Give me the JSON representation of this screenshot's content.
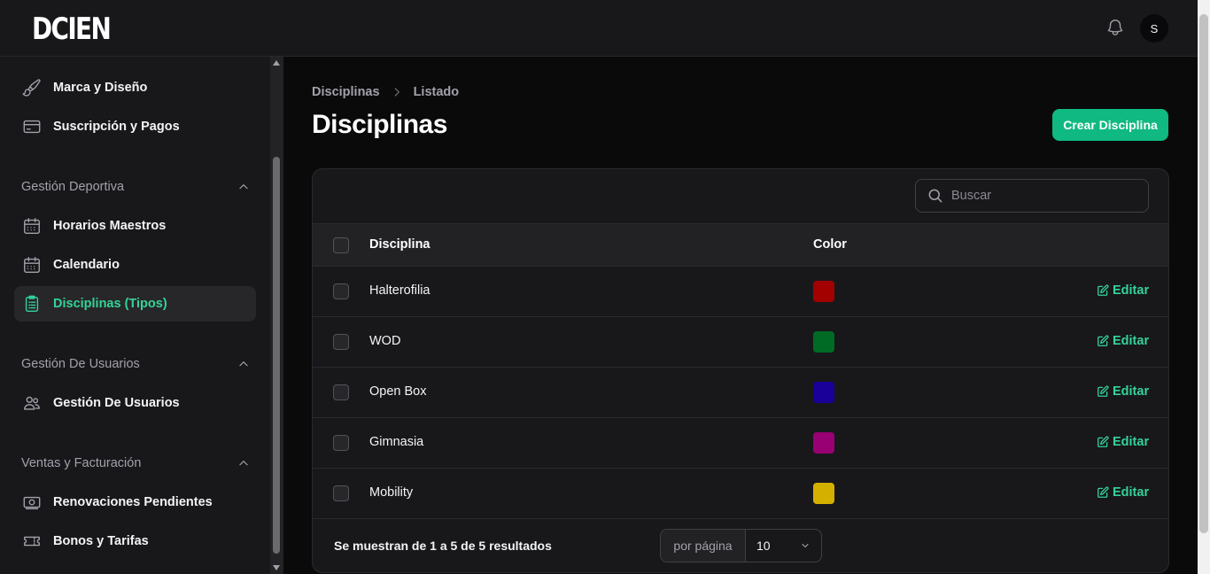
{
  "app": {
    "logo": "DCIEN",
    "avatar_initial": "S"
  },
  "sidebar": {
    "top_items": [
      {
        "label": "Marca y Diseño",
        "icon": "brush-icon"
      },
      {
        "label": "Suscripción y Pagos",
        "icon": "credit-card-icon"
      }
    ],
    "groups": [
      {
        "label": "Gestión Deportiva",
        "items": [
          {
            "label": "Horarios Maestros",
            "icon": "calendar-icon"
          },
          {
            "label": "Calendario",
            "icon": "calendar-icon"
          },
          {
            "label": "Disciplinas (Tipos)",
            "icon": "clipboard-list-icon",
            "active": true
          }
        ]
      },
      {
        "label": "Gestión De Usuarios",
        "items": [
          {
            "label": "Gestión De Usuarios",
            "icon": "users-icon"
          }
        ]
      },
      {
        "label": "Ventas y Facturación",
        "items": [
          {
            "label": "Renovaciones Pendientes",
            "icon": "banknotes-icon"
          },
          {
            "label": "Bonos y Tarifas",
            "icon": "ticket-icon"
          }
        ]
      }
    ]
  },
  "breadcrumb": {
    "parent": "Disciplinas",
    "current": "Listado"
  },
  "page": {
    "title": "Disciplinas",
    "create_label": "Crear Disciplina"
  },
  "search": {
    "placeholder": "Buscar"
  },
  "table": {
    "columns": {
      "name": "Disciplina",
      "color": "Color"
    },
    "edit_label": "Editar",
    "rows": [
      {
        "name": "Halterofilia",
        "color": "#a30000"
      },
      {
        "name": "WOD",
        "color": "#006b24"
      },
      {
        "name": "Open Box",
        "color": "#1a0099"
      },
      {
        "name": "Gimnasia",
        "color": "#990073"
      },
      {
        "name": "Mobility",
        "color": "#d4b000"
      }
    ]
  },
  "pagination": {
    "summary": "Se muestran de 1 a 5 de 5 resultados",
    "per_page_label": "por página",
    "per_page_value": "10"
  },
  "colors": {
    "accent": "#10b981",
    "accent_text": "#34d399",
    "background": "#0a0a0b",
    "panel": "#18181b"
  }
}
